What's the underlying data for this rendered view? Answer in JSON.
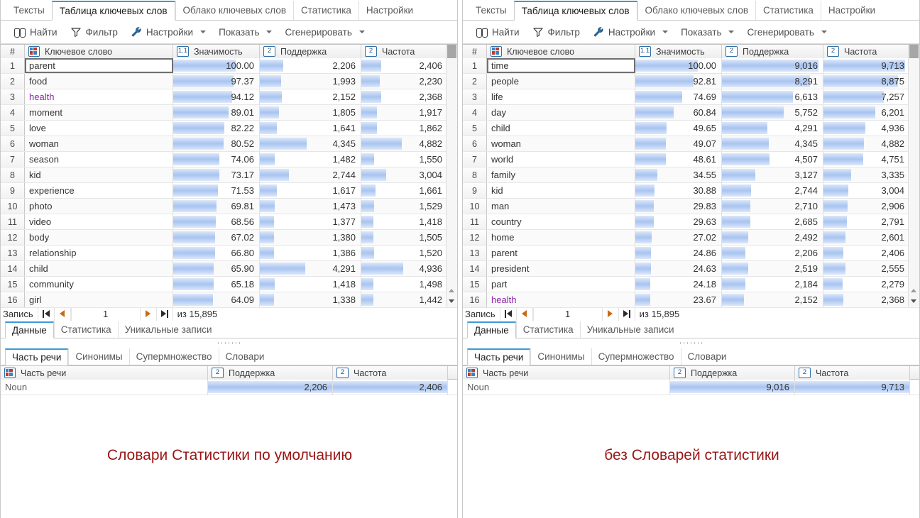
{
  "main_tabs": [
    {
      "label": "Тексты",
      "active": false
    },
    {
      "label": "Таблица ключевых слов",
      "active": true
    },
    {
      "label": "Облако ключевых слов",
      "active": false
    },
    {
      "label": "Статистика",
      "active": false
    },
    {
      "label": "Настройки",
      "active": false
    }
  ],
  "toolbar": [
    {
      "label": "Найти",
      "icon": "binoculars-icon",
      "caret": false
    },
    {
      "label": "Фильтр",
      "icon": "funnel-filter-icon",
      "caret": false
    },
    {
      "label": "Настройки",
      "icon": "wrench-icon",
      "caret": true
    },
    {
      "label": "Показать",
      "icon": "none",
      "caret": true
    },
    {
      "label": "Сгенерировать",
      "icon": "none",
      "caret": true
    }
  ],
  "grid_columns": [
    {
      "label": "#",
      "icon": "none",
      "type": "index"
    },
    {
      "label": "Ключевое слово",
      "icon": "text-column-icon",
      "type": "text"
    },
    {
      "label": "Значимость",
      "icon": "decimal-column-icon",
      "icon_text": "1.1",
      "type": "number"
    },
    {
      "label": "Поддержка",
      "icon": "integer-column-icon",
      "icon_text": "2",
      "type": "number"
    },
    {
      "label": "Частота",
      "icon": "integer-column-icon",
      "icon_text": "2",
      "type": "number"
    }
  ],
  "record_nav": {
    "label": "Запись",
    "current": "1",
    "of_label": "из 15,895",
    "first_icon": "go-first-icon",
    "prev_icon": "go-previous-icon",
    "next_icon": "go-next-icon",
    "last_icon": "go-last-icon"
  },
  "sub_tabs": [
    {
      "label": "Данные",
      "active": true
    },
    {
      "label": "Статистика",
      "active": false
    },
    {
      "label": "Уникальные записи",
      "active": false
    }
  ],
  "detail_tabs": [
    {
      "label": "Часть речи",
      "active": true
    },
    {
      "label": "Синонимы",
      "active": false
    },
    {
      "label": "Супермножество",
      "active": false
    },
    {
      "label": "Словари",
      "active": false
    }
  ],
  "detail_columns": [
    {
      "label": "Часть речи",
      "icon": "text-column-icon"
    },
    {
      "label": "Поддержка",
      "icon": "integer-column-icon",
      "icon_text": "2"
    },
    {
      "label": "Частота",
      "icon": "integer-column-icon",
      "icon_text": "2"
    }
  ],
  "colors": {
    "accent": "#3c9ad4",
    "caption_red": "#9b1515",
    "bar_blue": "#a8c4ef",
    "purple_keyword": "#8e24aa"
  },
  "left": {
    "caption": "Словари Статистики по умолчанию",
    "rows": [
      {
        "i": "1",
        "kw": "parent",
        "sig": "100.00",
        "sig_pct": 72,
        "sup": "2,206",
        "sup_pct": 23,
        "frq": "2,406",
        "frq_pct": 23,
        "selected": true,
        "purple": false
      },
      {
        "i": "2",
        "kw": "food",
        "sig": "97.37",
        "sig_pct": 70,
        "sup": "1,993",
        "sup_pct": 21,
        "frq": "2,230",
        "frq_pct": 21,
        "selected": false,
        "purple": false
      },
      {
        "i": "3",
        "kw": "health",
        "sig": "94.12",
        "sig_pct": 68,
        "sup": "2,152",
        "sup_pct": 22,
        "frq": "2,368",
        "frq_pct": 23,
        "selected": false,
        "purple": true
      },
      {
        "i": "4",
        "kw": "moment",
        "sig": "89.01",
        "sig_pct": 64,
        "sup": "1,805",
        "sup_pct": 19,
        "frq": "1,917",
        "frq_pct": 18,
        "selected": false,
        "purple": false
      },
      {
        "i": "5",
        "kw": "love",
        "sig": "82.22",
        "sig_pct": 59,
        "sup": "1,641",
        "sup_pct": 17,
        "frq": "1,862",
        "frq_pct": 18,
        "selected": false,
        "purple": false
      },
      {
        "i": "6",
        "kw": "woman",
        "sig": "80.52",
        "sig_pct": 58,
        "sup": "4,345",
        "sup_pct": 46,
        "frq": "4,882",
        "frq_pct": 47,
        "selected": false,
        "purple": false
      },
      {
        "i": "7",
        "kw": "season",
        "sig": "74.06",
        "sig_pct": 53,
        "sup": "1,482",
        "sup_pct": 15,
        "frq": "1,550",
        "frq_pct": 15,
        "selected": false,
        "purple": false
      },
      {
        "i": "8",
        "kw": "kid",
        "sig": "73.17",
        "sig_pct": 53,
        "sup": "2,744",
        "sup_pct": 29,
        "frq": "3,004",
        "frq_pct": 29,
        "selected": false,
        "purple": false
      },
      {
        "i": "9",
        "kw": "experience",
        "sig": "71.53",
        "sig_pct": 52,
        "sup": "1,617",
        "sup_pct": 17,
        "frq": "1,661",
        "frq_pct": 16,
        "selected": false,
        "purple": false
      },
      {
        "i": "10",
        "kw": "photo",
        "sig": "69.81",
        "sig_pct": 50,
        "sup": "1,473",
        "sup_pct": 15,
        "frq": "1,529",
        "frq_pct": 15,
        "selected": false,
        "purple": false
      },
      {
        "i": "11",
        "kw": "video",
        "sig": "68.56",
        "sig_pct": 49,
        "sup": "1,377",
        "sup_pct": 14,
        "frq": "1,418",
        "frq_pct": 14,
        "selected": false,
        "purple": false
      },
      {
        "i": "12",
        "kw": "body",
        "sig": "67.02",
        "sig_pct": 48,
        "sup": "1,380",
        "sup_pct": 14,
        "frq": "1,505",
        "frq_pct": 14,
        "selected": false,
        "purple": false
      },
      {
        "i": "13",
        "kw": "relationship",
        "sig": "66.80",
        "sig_pct": 48,
        "sup": "1,386",
        "sup_pct": 14,
        "frq": "1,520",
        "frq_pct": 15,
        "selected": false,
        "purple": false
      },
      {
        "i": "14",
        "kw": "child",
        "sig": "65.90",
        "sig_pct": 47,
        "sup": "4,291",
        "sup_pct": 45,
        "frq": "4,936",
        "frq_pct": 48,
        "selected": false,
        "purple": false
      },
      {
        "i": "15",
        "kw": "community",
        "sig": "65.18",
        "sig_pct": 47,
        "sup": "1,418",
        "sup_pct": 15,
        "frq": "1,498",
        "frq_pct": 14,
        "selected": false,
        "purple": false
      },
      {
        "i": "16",
        "kw": "girl",
        "sig": "64.09",
        "sig_pct": 46,
        "sup": "1,338",
        "sup_pct": 14,
        "frq": "1,442",
        "frq_pct": 14,
        "selected": false,
        "purple": false
      }
    ],
    "detail_row": {
      "pos": "Noun",
      "sup": "2,206",
      "frq": "2,406"
    }
  },
  "right": {
    "caption": "без Словарей статистики",
    "rows": [
      {
        "i": "1",
        "kw": "time",
        "sig": "100.00",
        "sig_pct": 72,
        "sup": "9,016",
        "sup_pct": 95,
        "frq": "9,713",
        "frq_pct": 94,
        "selected": true,
        "purple": false
      },
      {
        "i": "2",
        "kw": "people",
        "sig": "92.81",
        "sig_pct": 67,
        "sup": "8,291",
        "sup_pct": 87,
        "frq": "8,875",
        "frq_pct": 86,
        "selected": false,
        "purple": false
      },
      {
        "i": "3",
        "kw": "life",
        "sig": "74.69",
        "sig_pct": 54,
        "sup": "6,613",
        "sup_pct": 70,
        "frq": "7,257",
        "frq_pct": 70,
        "selected": false,
        "purple": false
      },
      {
        "i": "4",
        "kw": "day",
        "sig": "60.84",
        "sig_pct": 44,
        "sup": "5,752",
        "sup_pct": 61,
        "frq": "6,201",
        "frq_pct": 60,
        "selected": false,
        "purple": false
      },
      {
        "i": "5",
        "kw": "child",
        "sig": "49.65",
        "sig_pct": 36,
        "sup": "4,291",
        "sup_pct": 45,
        "frq": "4,936",
        "frq_pct": 48,
        "selected": false,
        "purple": false
      },
      {
        "i": "6",
        "kw": "woman",
        "sig": "49.07",
        "sig_pct": 35,
        "sup": "4,345",
        "sup_pct": 46,
        "frq": "4,882",
        "frq_pct": 47,
        "selected": false,
        "purple": false
      },
      {
        "i": "7",
        "kw": "world",
        "sig": "48.61",
        "sig_pct": 35,
        "sup": "4,507",
        "sup_pct": 47,
        "frq": "4,751",
        "frq_pct": 46,
        "selected": false,
        "purple": false
      },
      {
        "i": "8",
        "kw": "family",
        "sig": "34.55",
        "sig_pct": 25,
        "sup": "3,127",
        "sup_pct": 33,
        "frq": "3,335",
        "frq_pct": 32,
        "selected": false,
        "purple": false
      },
      {
        "i": "9",
        "kw": "kid",
        "sig": "30.88",
        "sig_pct": 22,
        "sup": "2,744",
        "sup_pct": 29,
        "frq": "3,004",
        "frq_pct": 29,
        "selected": false,
        "purple": false
      },
      {
        "i": "10",
        "kw": "man",
        "sig": "29.83",
        "sig_pct": 21,
        "sup": "2,710",
        "sup_pct": 28,
        "frq": "2,906",
        "frq_pct": 28,
        "selected": false,
        "purple": false
      },
      {
        "i": "11",
        "kw": "country",
        "sig": "29.63",
        "sig_pct": 21,
        "sup": "2,685",
        "sup_pct": 28,
        "frq": "2,791",
        "frq_pct": 27,
        "selected": false,
        "purple": false
      },
      {
        "i": "12",
        "kw": "home",
        "sig": "27.02",
        "sig_pct": 19,
        "sup": "2,492",
        "sup_pct": 26,
        "frq": "2,601",
        "frq_pct": 25,
        "selected": false,
        "purple": false
      },
      {
        "i": "13",
        "kw": "parent",
        "sig": "24.86",
        "sig_pct": 18,
        "sup": "2,206",
        "sup_pct": 23,
        "frq": "2,406",
        "frq_pct": 23,
        "selected": false,
        "purple": false
      },
      {
        "i": "14",
        "kw": "president",
        "sig": "24.63",
        "sig_pct": 18,
        "sup": "2,519",
        "sup_pct": 26,
        "frq": "2,555",
        "frq_pct": 25,
        "selected": false,
        "purple": false
      },
      {
        "i": "15",
        "kw": "part",
        "sig": "24.18",
        "sig_pct": 17,
        "sup": "2,184",
        "sup_pct": 23,
        "frq": "2,279",
        "frq_pct": 22,
        "selected": false,
        "purple": false
      },
      {
        "i": "16",
        "kw": "health",
        "sig": "23.67",
        "sig_pct": 17,
        "sup": "2,152",
        "sup_pct": 22,
        "frq": "2,368",
        "frq_pct": 23,
        "selected": false,
        "purple": true
      }
    ],
    "detail_row": {
      "pos": "Noun",
      "sup": "9,016",
      "frq": "9,713"
    }
  }
}
